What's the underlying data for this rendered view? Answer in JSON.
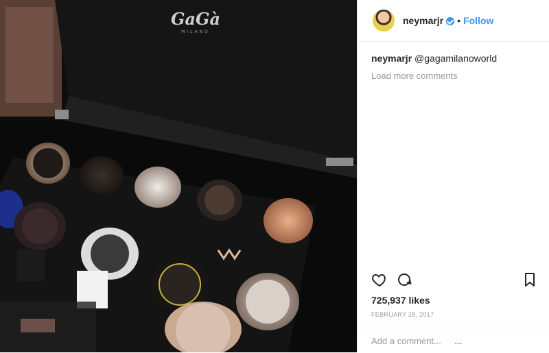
{
  "post": {
    "username": "neymarjr",
    "follow_label": "Follow",
    "separator": "•",
    "caption_user": "neymarjr",
    "caption_text": "@gagamilanoworld",
    "load_more": "Load more comments",
    "likes": "725,937 likes",
    "date": "FEBRUARY 28, 2017",
    "add_comment_placeholder": "Add a comment...",
    "more_options": "..."
  },
  "photo": {
    "brand_logo": "GaGà",
    "brand_sub": "MILANO"
  },
  "icons": {
    "heart": "heart-icon",
    "comment": "comment-icon",
    "bookmark": "bookmark-icon",
    "verified": "verified-icon"
  },
  "colors": {
    "accent": "#3897f0",
    "text": "#262626",
    "muted": "#999999"
  }
}
